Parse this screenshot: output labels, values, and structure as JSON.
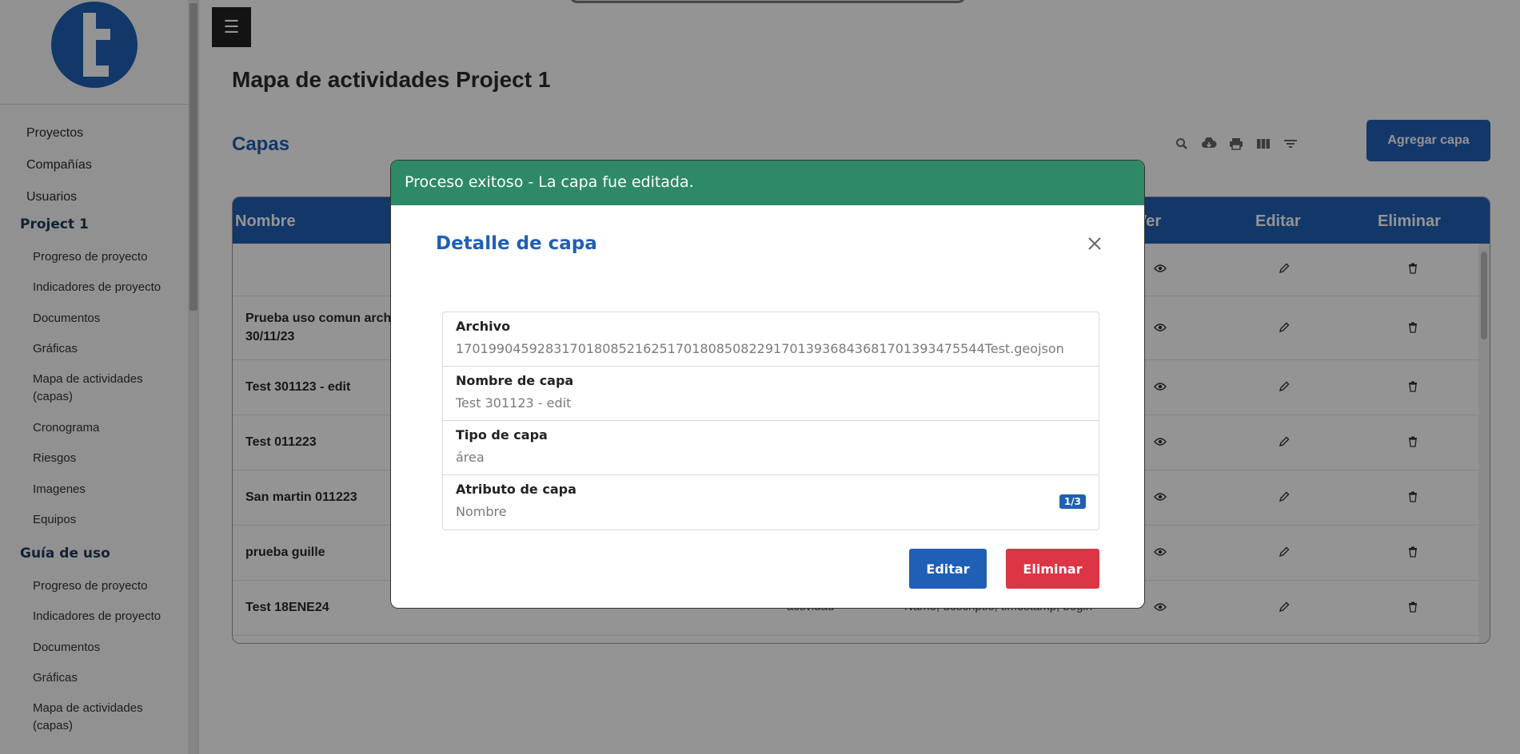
{
  "sidebar": {
    "top_items": [
      "Proyectos",
      "Compañías",
      "Usuarios"
    ],
    "project_section": "Project 1",
    "project_items": [
      "Progreso de proyecto",
      "Indicadores de proyecto",
      "Documentos",
      "Gráficas",
      "Mapa de actividades (capas)",
      "Cronograma",
      "Riesgos",
      "Imagenes",
      "Equipos"
    ],
    "guide_section": "Guía de uso",
    "guide_items": [
      "Progreso de proyecto",
      "Indicadores de proyecto",
      "Documentos",
      "Gráficas",
      "Mapa de actividades (capas)"
    ]
  },
  "header": {
    "menu_icon": "☰",
    "page_title": "Mapa de actividades Project 1"
  },
  "capas": {
    "title": "Capas",
    "add_button": "Agregar capa",
    "toolbar_icons": [
      "search-icon",
      "cloud-download-icon",
      "print-icon",
      "columns-icon",
      "filter-icon"
    ]
  },
  "table": {
    "columns": [
      "Nombre",
      "Ver",
      "Editar",
      "Eliminar"
    ],
    "rows": [
      {
        "name": "",
        "type": "",
        "attrs": ""
      },
      {
        "name": "Prueba uso comun arch",
        "name2": "30/11/23",
        "type": "",
        "attrs": ""
      },
      {
        "name": "Test 301123 - edit",
        "type": "",
        "attrs": ""
      },
      {
        "name": "Test 011223",
        "type": "",
        "attrs": ""
      },
      {
        "name": "San martin 011223",
        "type": "",
        "attrs": ""
      },
      {
        "name": "prueba guille",
        "type": "",
        "attrs": ""
      },
      {
        "name": "Test 18ENE24",
        "type": "actividad",
        "attrs": "Name, descriptio, timestamp, begin"
      }
    ]
  },
  "modal": {
    "toast": "Proceso exitoso - La capa fue editada.",
    "title": "Detalle de capa",
    "fields": [
      {
        "label": "Archivo",
        "value": "17019904592831701808521625170180850822917013936843681701393475544Test.geojson"
      },
      {
        "label": "Nombre de capa",
        "value": "Test 301123 - edit"
      },
      {
        "label": "Tipo de capa",
        "value": "área"
      },
      {
        "label": "Atributo de capa",
        "value": "Nombre",
        "badge": "1/3"
      }
    ],
    "edit_button": "Editar",
    "delete_button": "Eliminar"
  },
  "colors": {
    "primary": "#1f5fb5",
    "success": "#2e8a66",
    "danger": "#dc3545"
  }
}
